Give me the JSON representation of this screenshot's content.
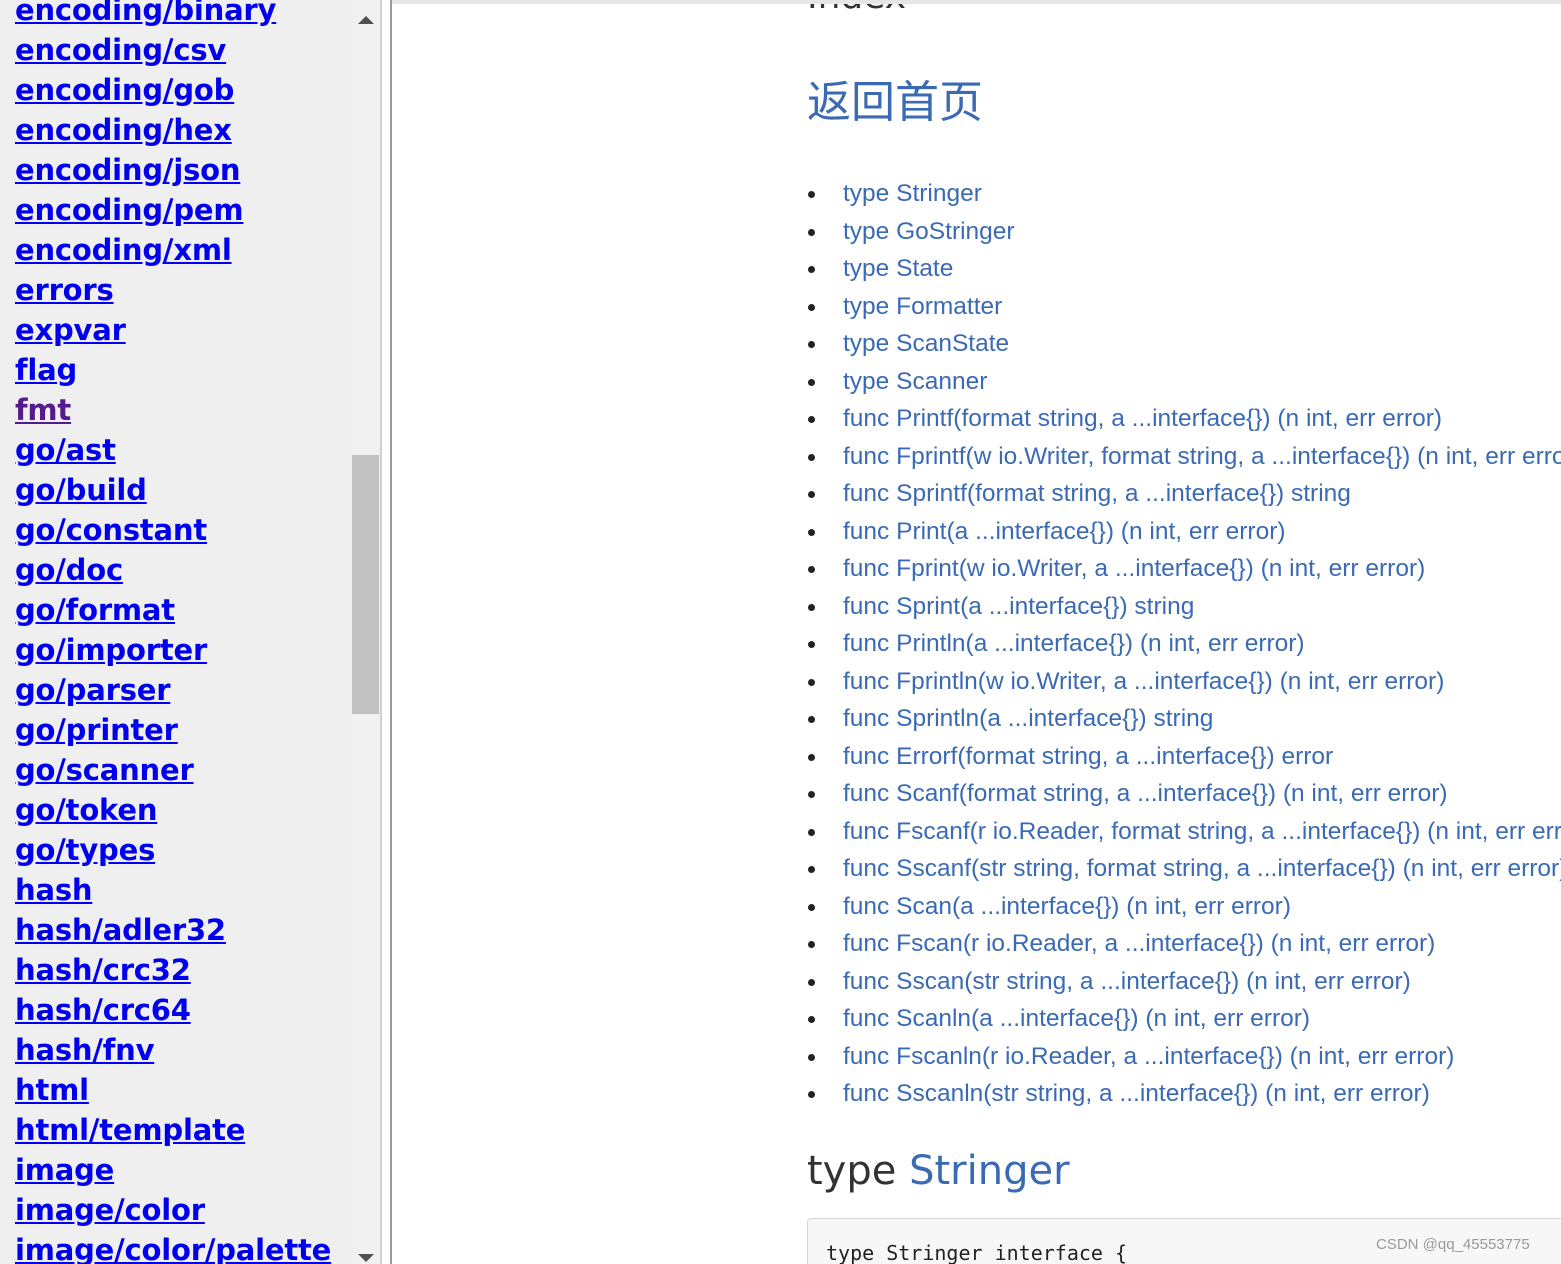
{
  "sidebar": {
    "items": [
      {
        "label": "encoding/binary"
      },
      {
        "label": "encoding/csv"
      },
      {
        "label": "encoding/gob"
      },
      {
        "label": "encoding/hex"
      },
      {
        "label": "encoding/json"
      },
      {
        "label": "encoding/pem"
      },
      {
        "label": "encoding/xml"
      },
      {
        "label": "errors"
      },
      {
        "label": "expvar"
      },
      {
        "label": "flag"
      },
      {
        "label": "fmt"
      },
      {
        "label": "go/ast"
      },
      {
        "label": "go/build"
      },
      {
        "label": "go/constant"
      },
      {
        "label": "go/doc"
      },
      {
        "label": "go/format"
      },
      {
        "label": "go/importer"
      },
      {
        "label": "go/parser"
      },
      {
        "label": "go/printer"
      },
      {
        "label": "go/scanner"
      },
      {
        "label": "go/token"
      },
      {
        "label": "go/types"
      },
      {
        "label": "hash"
      },
      {
        "label": "hash/adler32"
      },
      {
        "label": "hash/crc32"
      },
      {
        "label": "hash/crc64"
      },
      {
        "label": "hash/fnv"
      },
      {
        "label": "html"
      },
      {
        "label": "html/template"
      },
      {
        "label": "image"
      },
      {
        "label": "image/color"
      },
      {
        "label": "image/color/palette"
      }
    ],
    "visited_item": "fmt"
  },
  "main": {
    "index_heading": "Index",
    "home_link": "返回首页",
    "index_items": [
      {
        "label": "type Stringer"
      },
      {
        "label": "type GoStringer"
      },
      {
        "label": "type State"
      },
      {
        "label": "type Formatter"
      },
      {
        "label": "type ScanState"
      },
      {
        "label": "type Scanner"
      },
      {
        "label": "func Printf(format string, a ...interface{}) (n int, err error)"
      },
      {
        "label": "func Fprintf(w io.Writer, format string, a ...interface{}) (n int, err error)"
      },
      {
        "label": "func Sprintf(format string, a ...interface{}) string"
      },
      {
        "label": "func Print(a ...interface{}) (n int, err error)"
      },
      {
        "label": "func Fprint(w io.Writer, a ...interface{}) (n int, err error)"
      },
      {
        "label": "func Sprint(a ...interface{}) string"
      },
      {
        "label": "func Println(a ...interface{}) (n int, err error)"
      },
      {
        "label": "func Fprintln(w io.Writer, a ...interface{}) (n int, err error)"
      },
      {
        "label": "func Sprintln(a ...interface{}) string"
      },
      {
        "label": "func Errorf(format string, a ...interface{}) error"
      },
      {
        "label": "func Scanf(format string, a ...interface{}) (n int, err error)"
      },
      {
        "label": "func Fscanf(r io.Reader, format string, a ...interface{}) (n int, err error)"
      },
      {
        "label": "func Sscanf(str string, format string, a ...interface{}) (n int, err error)"
      },
      {
        "label": "func Scan(a ...interface{}) (n int, err error)"
      },
      {
        "label": "func Fscan(r io.Reader, a ...interface{}) (n int, err error)"
      },
      {
        "label": "func Sscan(str string, a ...interface{}) (n int, err error)"
      },
      {
        "label": "func Scanln(a ...interface{}) (n int, err error)"
      },
      {
        "label": "func Fscanln(r io.Reader, a ...interface{}) (n int, err error)"
      },
      {
        "label": "func Sscanln(str string, a ...interface{}) (n int, err error)"
      }
    ],
    "section_heading": {
      "prefix": "type",
      "name": "Stringer"
    },
    "code_snippet": "type Stringer interface {"
  },
  "watermark": "CSDN @qq_45553775",
  "colors": {
    "sidebar_link": "#0000ee",
    "sidebar_visited": "#551a8b",
    "main_link": "#3b6ab5",
    "sidebar_bg": "#efefef",
    "scroll_thumb": "#c1c1c1"
  }
}
